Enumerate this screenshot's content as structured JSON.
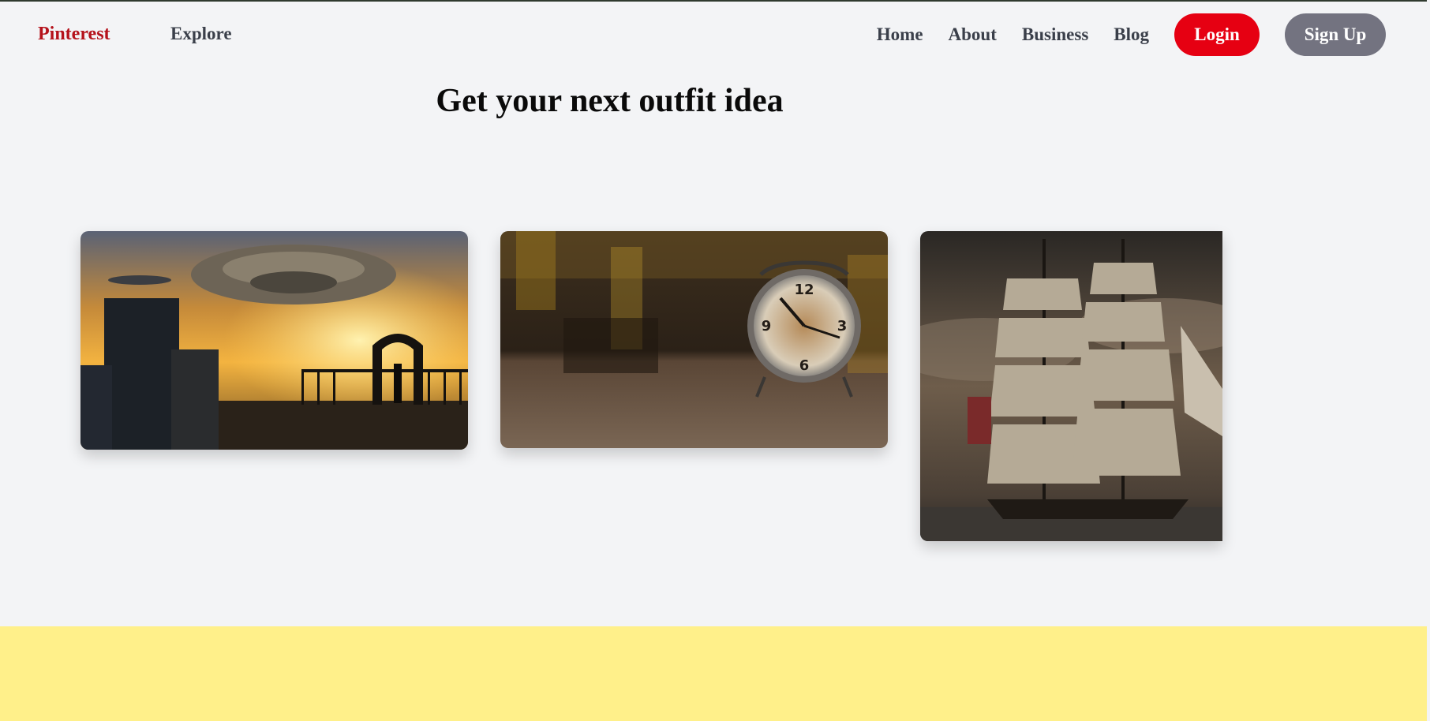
{
  "nav": {
    "brand": "Pinterest",
    "explore": "Explore",
    "links": [
      "Home",
      "About",
      "Business",
      "Blog"
    ],
    "login_label": "Login",
    "signup_label": "Sign Up"
  },
  "hero": {
    "headline": "Get your next outfit idea"
  },
  "colors": {
    "brand_red": "#b5121b",
    "login_red": "#e60012",
    "signup_gray": "#737380",
    "background": "#f3f4f6",
    "footer_band": "#fff08a"
  },
  "gallery": {
    "images": [
      {
        "subject": "sci-fi city with spaceship at sunset"
      },
      {
        "subject": "antique alarm clock on wooden table"
      },
      {
        "subject": "tall sailing ship under cloudy sky"
      }
    ]
  }
}
